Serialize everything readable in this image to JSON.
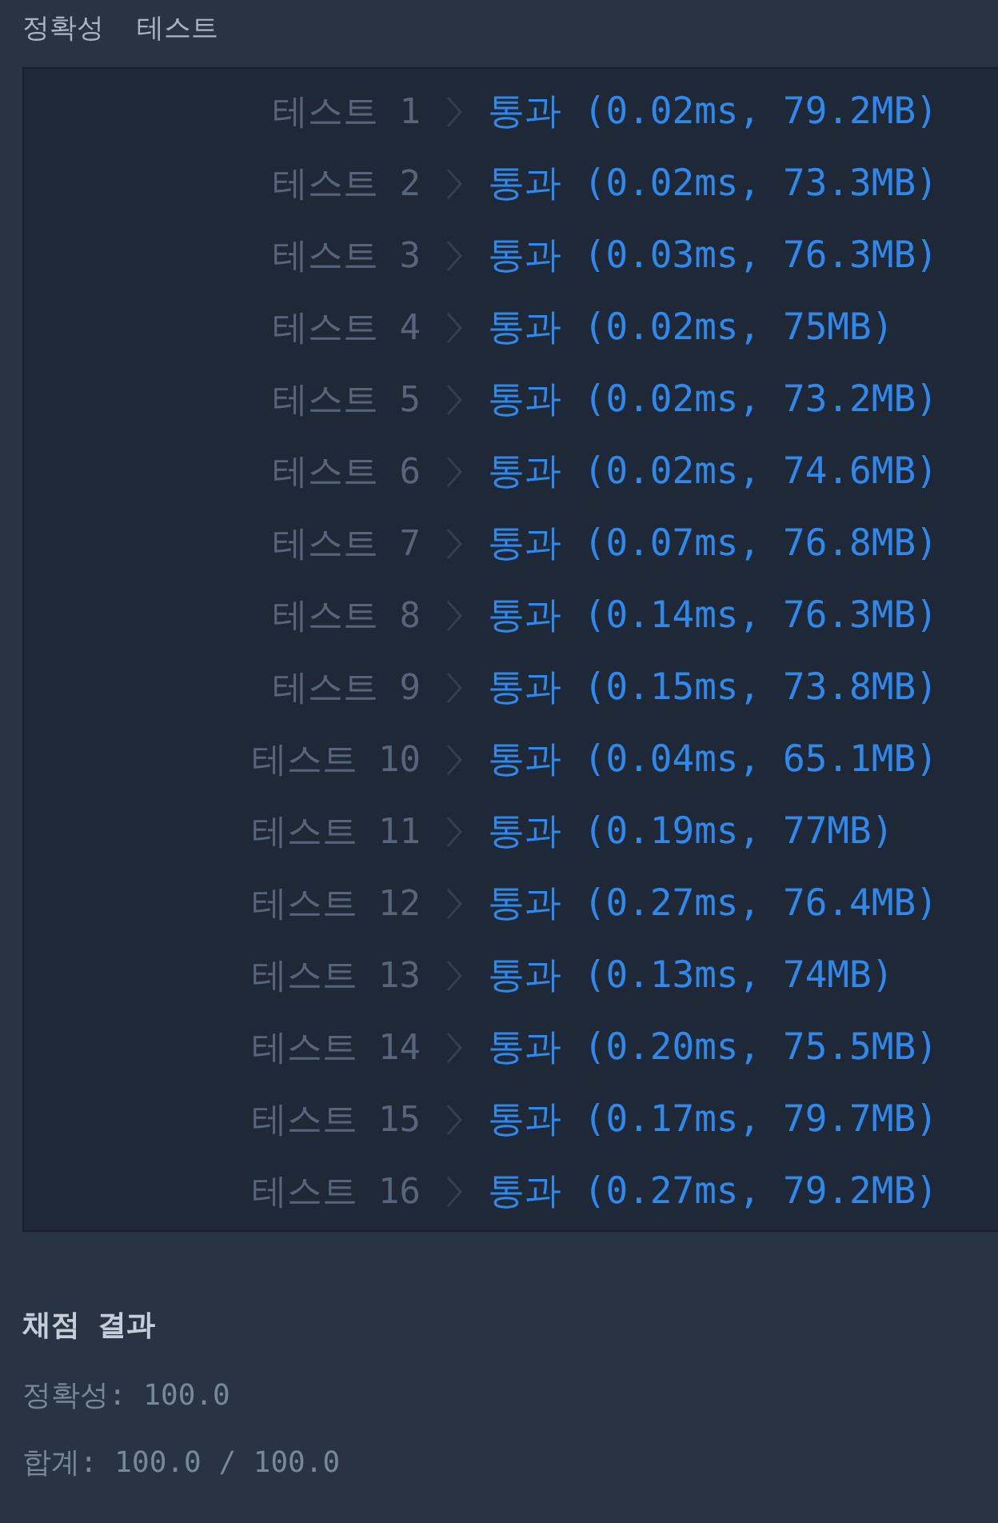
{
  "section_title": "정확성  테스트",
  "tests": [
    {
      "label": "테스트 1",
      "result": "통과 (0.02ms, 79.2MB)",
      "passed": true
    },
    {
      "label": "테스트 2",
      "result": "통과 (0.02ms, 73.3MB)",
      "passed": true
    },
    {
      "label": "테스트 3",
      "result": "통과 (0.03ms, 76.3MB)",
      "passed": true
    },
    {
      "label": "테스트 4",
      "result": "통과 (0.02ms, 75MB)",
      "passed": true
    },
    {
      "label": "테스트 5",
      "result": "통과 (0.02ms, 73.2MB)",
      "passed": true
    },
    {
      "label": "테스트 6",
      "result": "통과 (0.02ms, 74.6MB)",
      "passed": true
    },
    {
      "label": "테스트 7",
      "result": "통과 (0.07ms, 76.8MB)",
      "passed": true
    },
    {
      "label": "테스트 8",
      "result": "통과 (0.14ms, 76.3MB)",
      "passed": true
    },
    {
      "label": "테스트 9",
      "result": "통과 (0.15ms, 73.8MB)",
      "passed": true
    },
    {
      "label": "테스트 10",
      "result": "통과 (0.04ms, 65.1MB)",
      "passed": true
    },
    {
      "label": "테스트 11",
      "result": "통과 (0.19ms, 77MB)",
      "passed": true
    },
    {
      "label": "테스트 12",
      "result": "통과 (0.27ms, 76.4MB)",
      "passed": true
    },
    {
      "label": "테스트 13",
      "result": "통과 (0.13ms, 74MB)",
      "passed": true
    },
    {
      "label": "테스트 14",
      "result": "통과 (0.20ms, 75.5MB)",
      "passed": true
    },
    {
      "label": "테스트 15",
      "result": "통과 (0.17ms, 79.7MB)",
      "passed": true
    },
    {
      "label": "테스트 16",
      "result": "통과 (0.27ms, 79.2MB)",
      "passed": true
    }
  ],
  "summary": {
    "title": "채점 결과",
    "lines": [
      "정확성: 100.0",
      "합계: 100.0 / 100.0"
    ]
  }
}
